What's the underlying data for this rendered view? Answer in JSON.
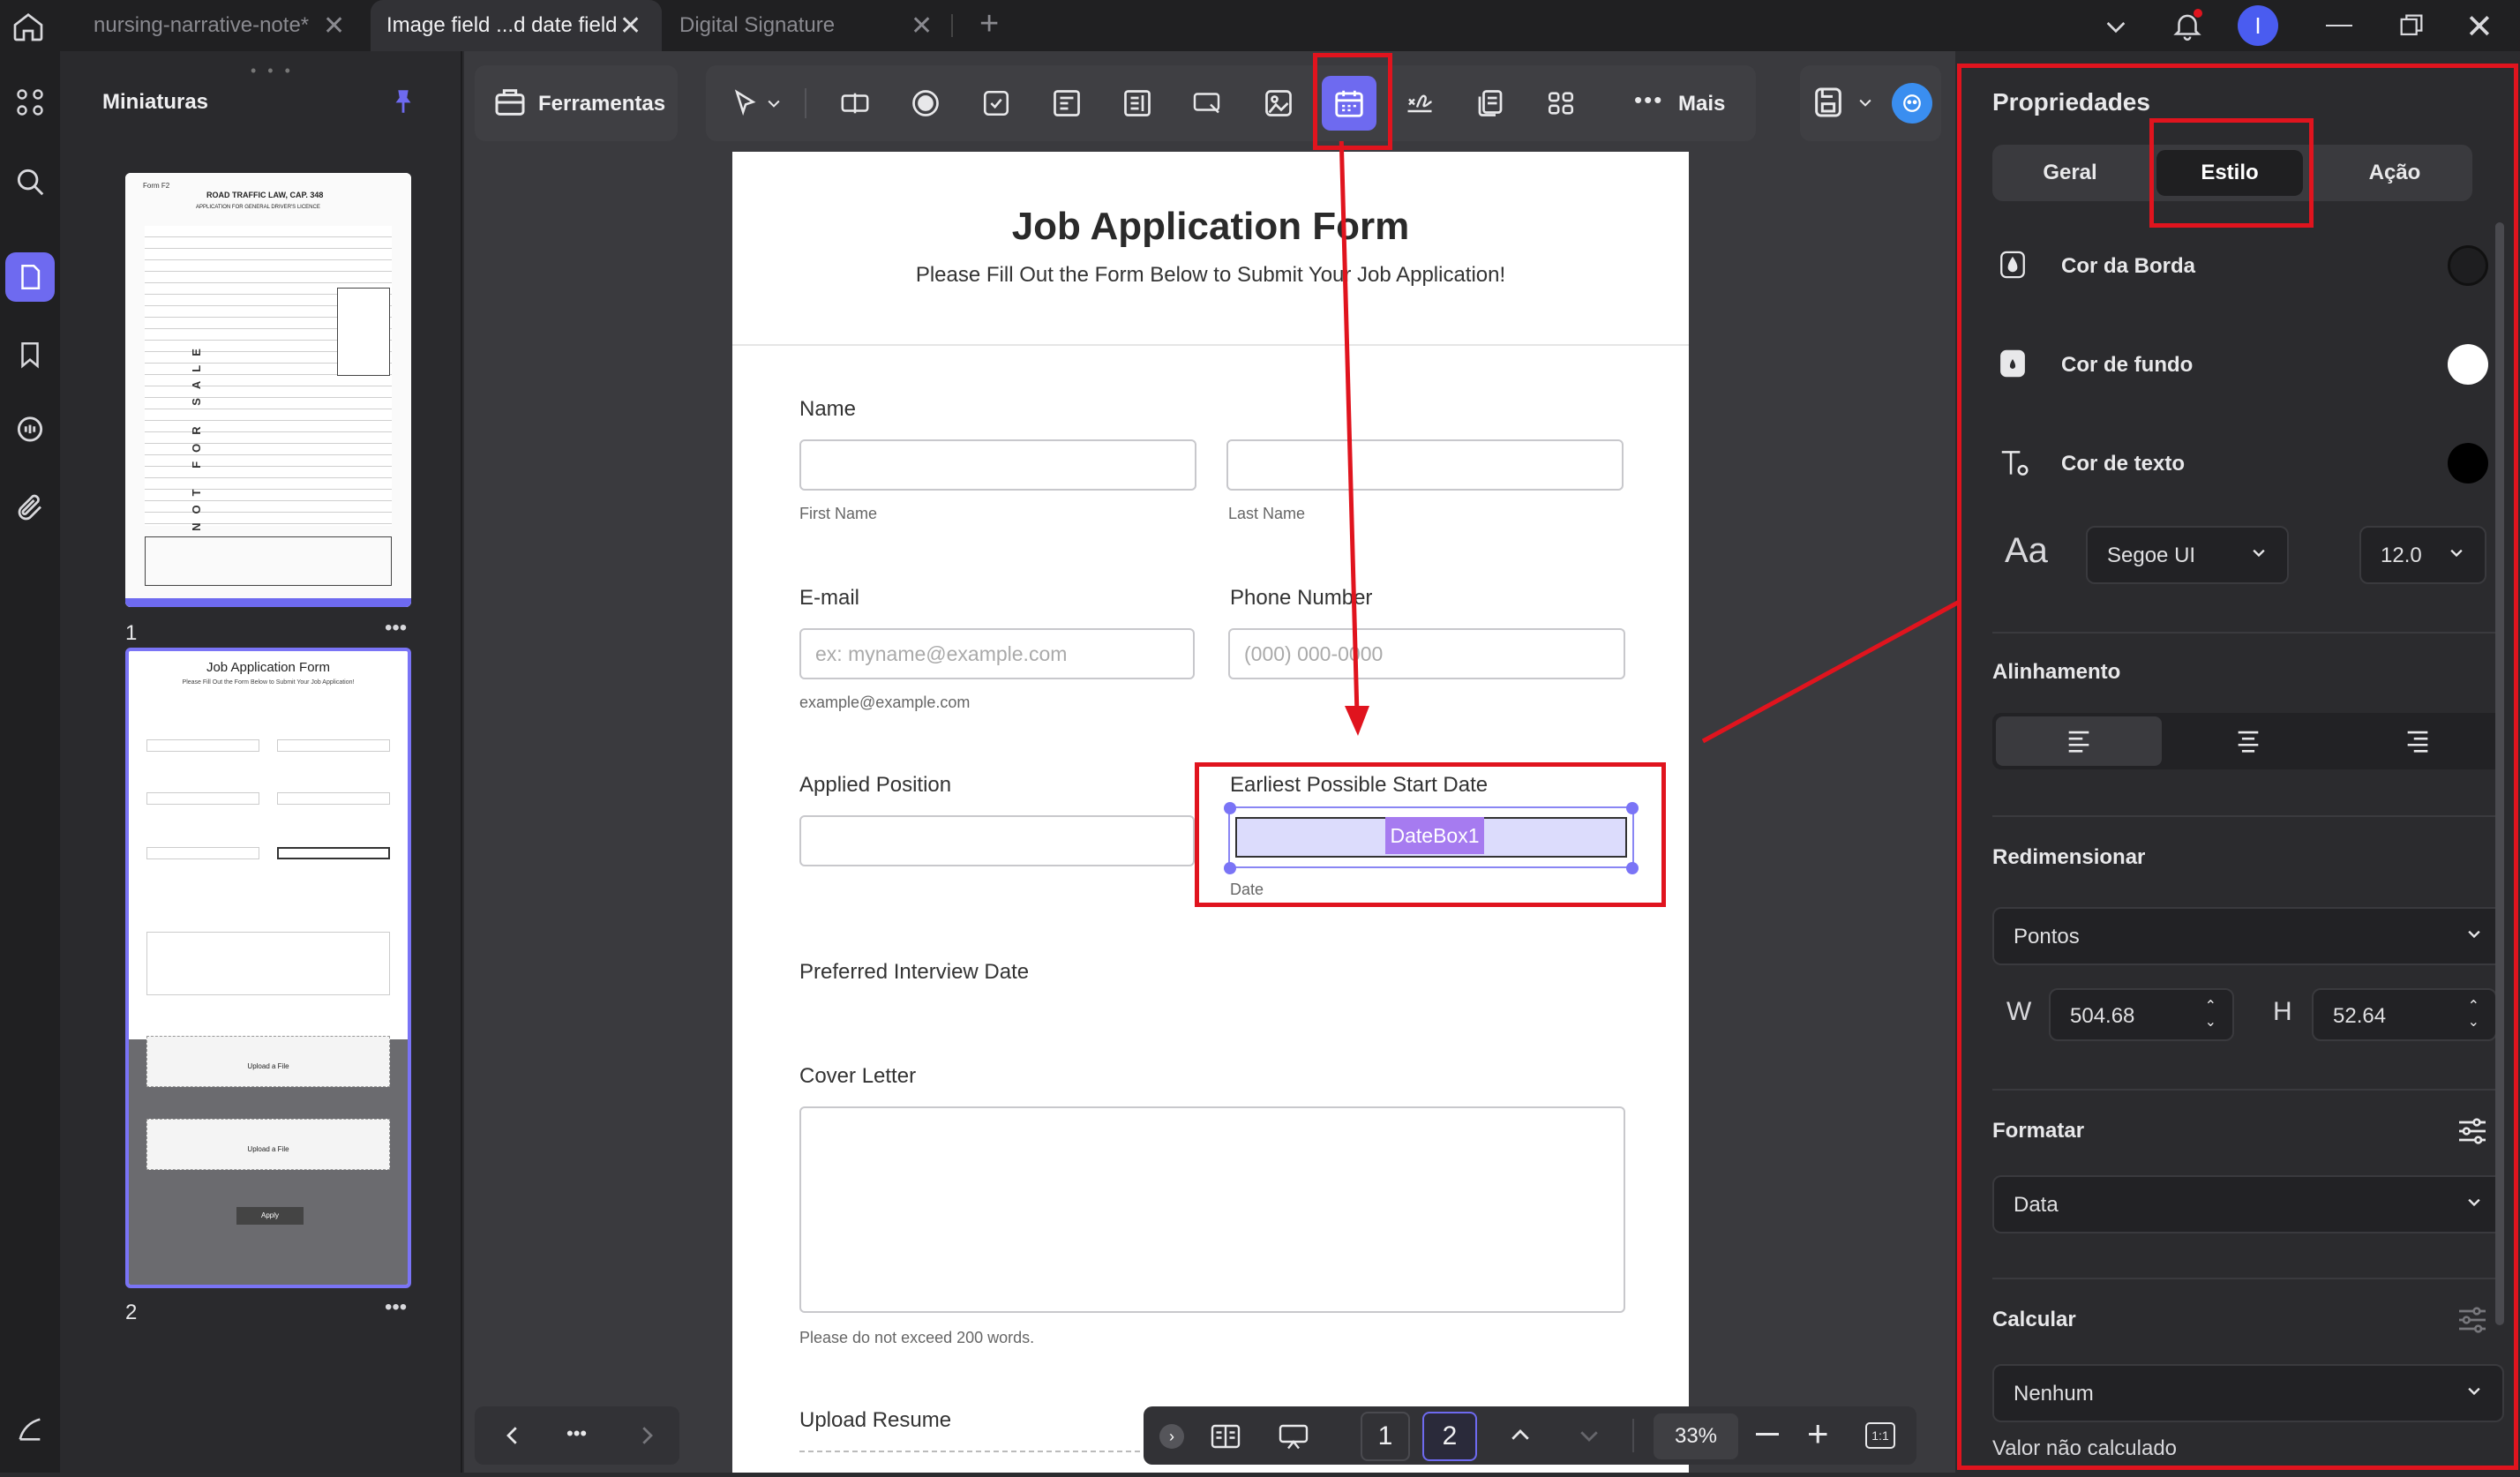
{
  "tabs": [
    {
      "label": "nursing-narrative-note*"
    },
    {
      "label": "Image field ...d date field"
    },
    {
      "label": "Digital Signature"
    }
  ],
  "user": {
    "initial": "I"
  },
  "thumbnails": {
    "title": "Miniaturas",
    "pages": [
      {
        "num": "1"
      },
      {
        "num": "2"
      }
    ],
    "thumb1": {
      "line1": "Form F2",
      "line2": "ROAD TRAFFIC LAW, CAP. 348",
      "line3": "APPLICATION FOR GENERAL DRIVER'S LICENCE",
      "side_text": "NOT FOR SALE"
    },
    "thumb2": {
      "title": "Job Application Form",
      "subtitle": "Please Fill Out the Form Below to Submit Your Job Application!",
      "upload": "Upload a File",
      "apply": "Apply"
    }
  },
  "toolbar": {
    "tools_label": "Ferramentas",
    "more_label": "Mais"
  },
  "form": {
    "title": "Job Application Form",
    "subtitle": "Please Fill Out the Form Below to Submit Your Job Application!",
    "name_label": "Name",
    "first_name": "First Name",
    "last_name": "Last Name",
    "email_label": "E-mail",
    "email_placeholder": "ex: myname@example.com",
    "email_hint": "example@example.com",
    "phone_label": "Phone Number",
    "phone_placeholder": "(000) 000-0000",
    "applied_position": "Applied Position",
    "start_date_label": "Earliest Possible Start Date",
    "datebox": "DateBox1",
    "date_hint": "Date",
    "interview_label": "Preferred Interview Date",
    "cover_label": "Cover Letter",
    "cover_hint": "Please do not exceed 200 words.",
    "upload_label": "Upload Resume"
  },
  "bottombar": {
    "page1": "1",
    "page2": "2",
    "zoom": "33%",
    "fit": "1:1"
  },
  "properties": {
    "title": "Propriedades",
    "tabs": [
      "Geral",
      "Estilo",
      "Ação"
    ],
    "border_color": "Cor da Borda",
    "bg_color": "Cor de fundo",
    "text_color": "Cor de texto",
    "font_icon": "Aa",
    "font": "Segoe UI",
    "font_size": "12.0",
    "alignment": "Alinhamento",
    "resize": "Redimensionar",
    "units": "Pontos",
    "w_label": "W",
    "w_value": "504.68",
    "h_label": "H",
    "h_value": "52.64",
    "format": "Formatar",
    "format_value": "Data",
    "calculate": "Calcular",
    "calc_value": "Nenhum",
    "calc_note": "Valor não calculado"
  },
  "colors": {
    "accent": "#6e6af0",
    "red": "#e0141e",
    "datebox_bg": "#dcdcfc",
    "datebox_label": "#a67bf0"
  }
}
